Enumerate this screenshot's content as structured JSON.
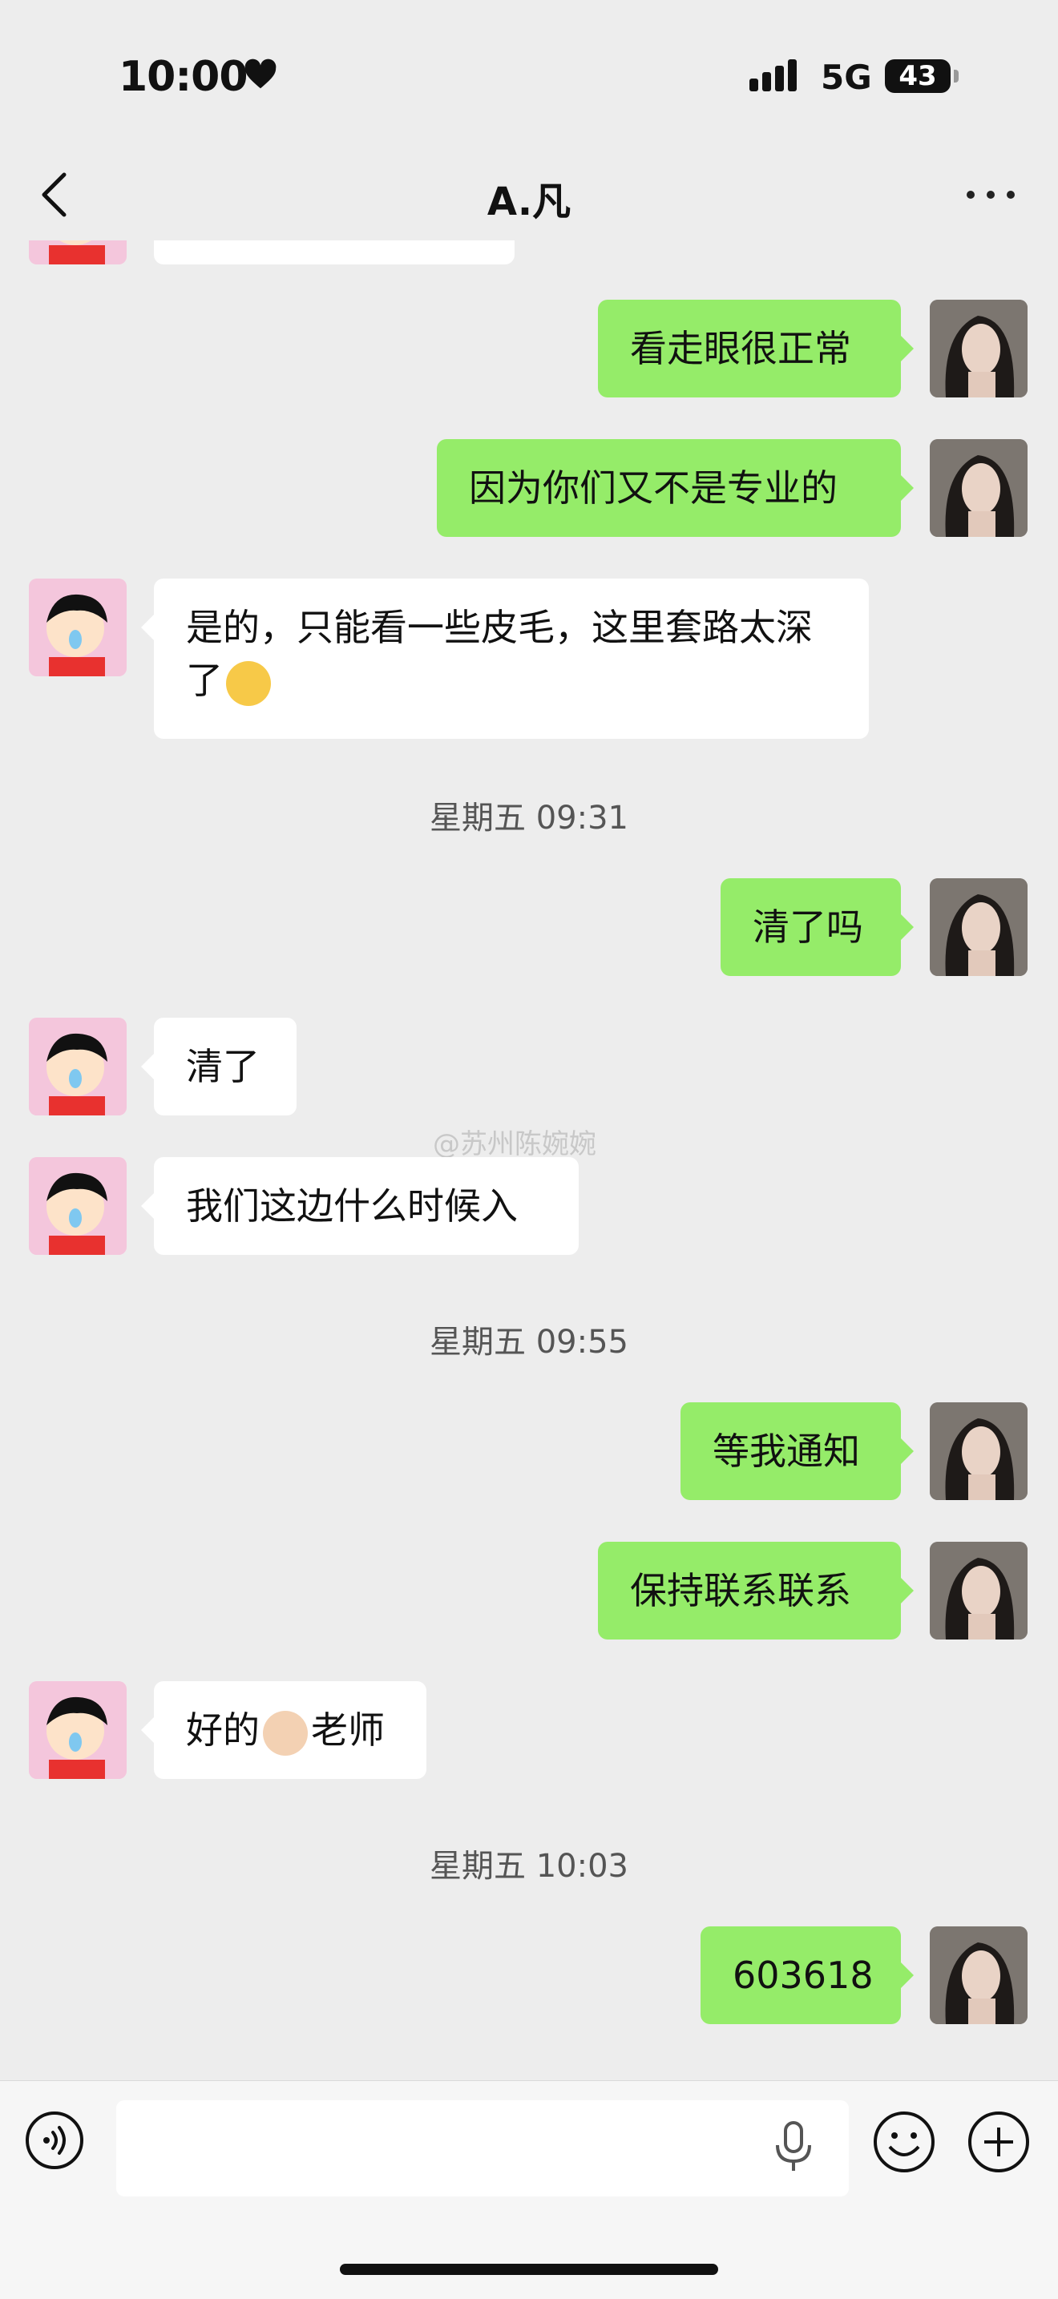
{
  "status_bar": {
    "time": "10:00",
    "network": "5G",
    "battery": "43"
  },
  "header": {
    "title": "A.凡"
  },
  "messages": [
    {
      "text": "看走眼很正常"
    },
    {
      "text": "因为你们又不是专业的"
    },
    {
      "text": "是的，只能看一些皮毛，这里套路太深了"
    },
    {
      "text": "清了吗"
    },
    {
      "text": "清了"
    },
    {
      "text": "我们这边什么时候入"
    },
    {
      "text": "等我通知"
    },
    {
      "text": "保持联系联系"
    },
    {
      "text_before": "好的",
      "text_after": "老师"
    },
    {
      "text": "603618"
    }
  ],
  "timestamps": [
    "星期五 09:31",
    "星期五 09:55",
    "星期五 10:03"
  ],
  "watermark": "@苏州陈婉婉",
  "colors": {
    "outgoing_bubble": "#95ec69",
    "incoming_bubble": "#ffffff",
    "background": "#ededed"
  }
}
